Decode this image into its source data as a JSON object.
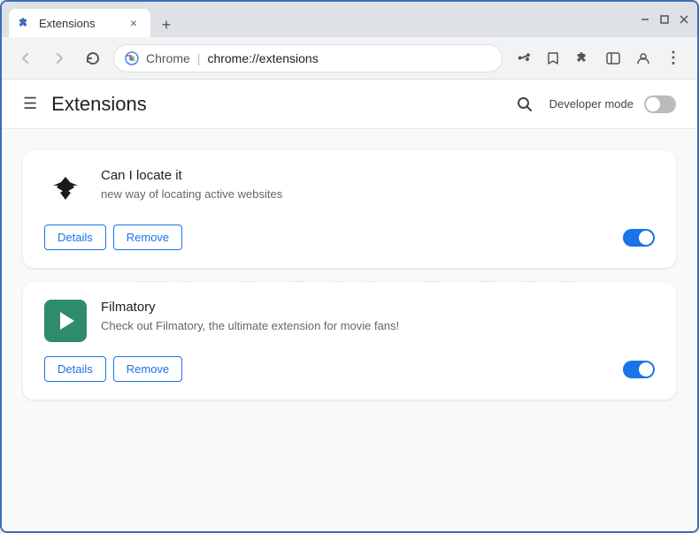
{
  "browser": {
    "tab_title": "Extensions",
    "tab_close_label": "×",
    "new_tab_label": "+",
    "window_controls": {
      "minimize": "—",
      "maximize": "□",
      "close": "✕"
    },
    "nav": {
      "back_label": "←",
      "forward_label": "→",
      "reload_label": "↻",
      "chrome_label": "Chrome",
      "url": "chrome://extensions",
      "share_icon": "share",
      "star_icon": "star",
      "extensions_icon": "puzzle",
      "sidebar_icon": "sidebar",
      "profile_icon": "person",
      "menu_icon": "⋮"
    }
  },
  "page": {
    "title": "Extensions",
    "hamburger_label": "☰",
    "search_label": "🔍",
    "dev_mode_label": "Developer mode",
    "dev_mode_enabled": false
  },
  "extensions": [
    {
      "id": "ext1",
      "name": "Can I locate it",
      "description": "new way of locating active websites",
      "enabled": true,
      "details_label": "Details",
      "remove_label": "Remove"
    },
    {
      "id": "ext2",
      "name": "Filmatory",
      "description": "Check out Filmatory, the ultimate extension for movie fans!",
      "enabled": true,
      "details_label": "Details",
      "remove_label": "Remove"
    }
  ],
  "watermark": "FLASH.COM"
}
